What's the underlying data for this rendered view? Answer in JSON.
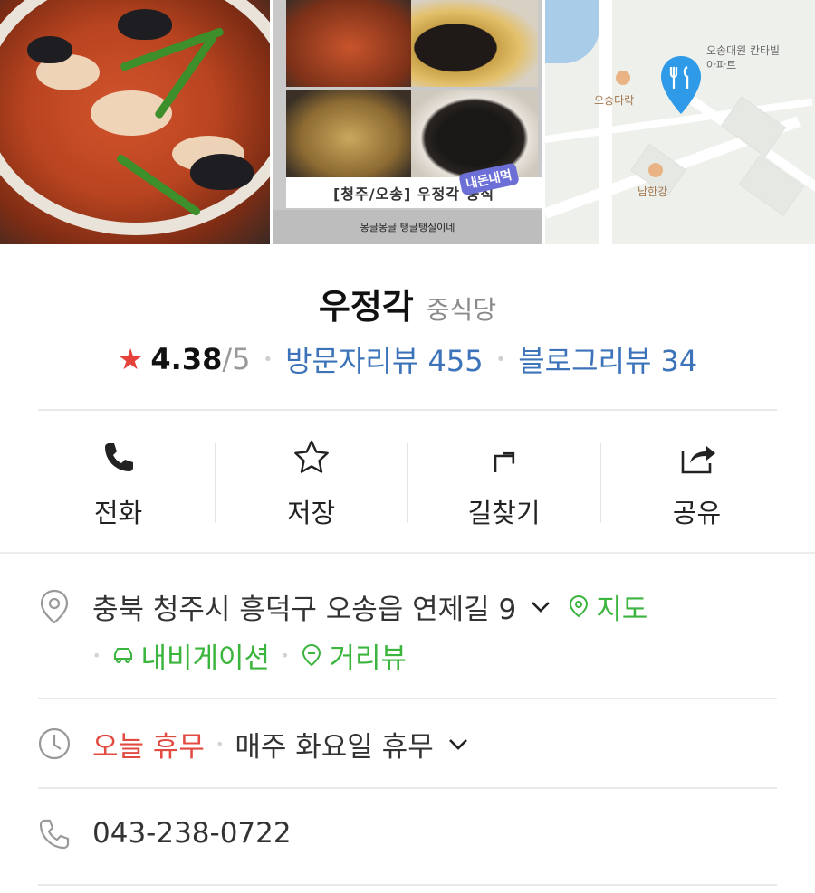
{
  "photos": {
    "promo_caption": "[청주/오송] 우정각 중식",
    "promo_footer": "몽글몽글 탱글탱실이네",
    "promo_sticker": "내돈내먹",
    "map_labels": [
      "오송대원 칸타빌아파트",
      "오송다락",
      "남한강"
    ]
  },
  "place": {
    "name": "우정각",
    "category": "중식당",
    "rating": "4.38",
    "rating_max": "/5",
    "visit_reviews": "방문자리뷰 455",
    "blog_reviews": "블로그리뷰 34"
  },
  "actions": [
    {
      "label": "전화",
      "icon": "phone-icon"
    },
    {
      "label": "저장",
      "icon": "star-outline-icon"
    },
    {
      "label": "길찾기",
      "icon": "directions-icon"
    },
    {
      "label": "공유",
      "icon": "share-icon"
    }
  ],
  "address": {
    "text": "충북 청주시 흥덕구 오송읍 연제길 9",
    "map_link": "지도",
    "navigation_link": "내비게이션",
    "streetview_link": "거리뷰"
  },
  "hours": {
    "status": "오늘 휴무",
    "detail": "매주 화요일 휴무"
  },
  "phone": {
    "number": "043-238-0722"
  },
  "colors": {
    "rating_star": "#e5423b",
    "review_link": "#3d74b9",
    "green_link": "#3cb53e",
    "closed_red": "#e24b42",
    "map_pin": "#2f9be8"
  }
}
